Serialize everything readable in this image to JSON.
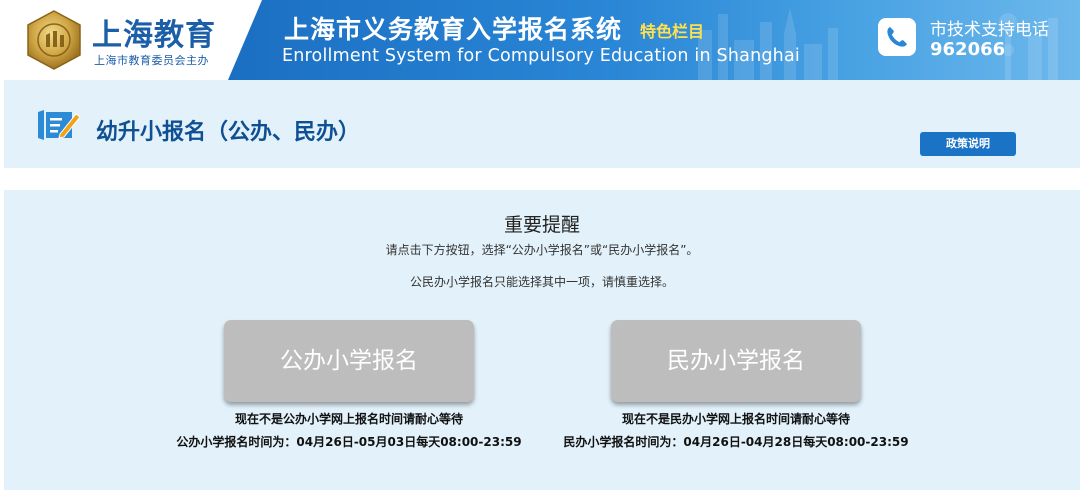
{
  "header": {
    "brand_title": "上海教育",
    "brand_subtitle": "上海市教育委员会主办",
    "system_title": "上海市义务教育入学报名系统",
    "system_tag": "特色栏目",
    "system_title_en": "Enrollment System for Compulsory Education in Shanghai",
    "support_label": "市技术支持电话",
    "support_phone": "962066",
    "icons": {
      "logo": "education-seal-icon",
      "phone": "phone-icon"
    }
  },
  "titlebar": {
    "title": "幼升小报名（公办、民办）",
    "policy_button": "政策说明",
    "icon": "edit-form-icon"
  },
  "notice": {
    "title": "重要提醒",
    "line1": "请点击下方按钮，选择“公办小学报名”或“民办小学报名”。",
    "line2": "公民办小学报名只能选择其中一项，请慎重选择。"
  },
  "public": {
    "button": "公办小学报名",
    "status": "现在不是公办小学网上报名时间请耐心等待",
    "period": "公办小学报名时间为：04月26日-05月03日每天08:00-23:59"
  },
  "private": {
    "button": "民办小学报名",
    "status": "现在不是民办小学网上报名时间请耐心等待",
    "period": "民办小学报名时间为：04月26日-04月28日每天08:00-23:59"
  },
  "colors": {
    "brand_blue": "#1c5fa8",
    "banner_blue": "#2a86d6",
    "tag_yellow": "#ffe14d",
    "panel_bg": "#e2f1fa",
    "button_gray": "#bdbdbd",
    "policy_button": "#1a73c4"
  }
}
